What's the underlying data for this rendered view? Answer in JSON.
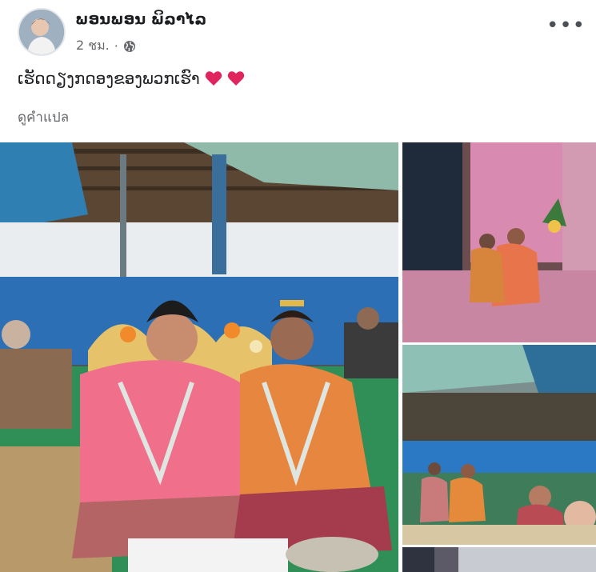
{
  "post": {
    "author_name": "ພອນພອນ ພິລາໄລ",
    "time": "2 ชม.",
    "separator": "·",
    "privacy_icon": "globe-icon",
    "more_icon": "more-options-icon",
    "more_label": "•••",
    "caption": "ເຮັດດຽງກດອງຂອງພວກເຮົາ",
    "caption_emoji": [
      "red-heart",
      "red-heart"
    ],
    "translate_label": "ดูคำแปล"
  },
  "photos": [
    {
      "name": "wedding-photo-main",
      "description": "couple in pink and orange attire seated with money garlands"
    },
    {
      "name": "wedding-photo-top-right",
      "description": "couple seated under pink backdrop"
    },
    {
      "name": "wedding-photo-middle-right",
      "description": "ceremony crowd under blue tent"
    },
    {
      "name": "wedding-photo-bottom-right",
      "description": "partially visible photo"
    }
  ],
  "colors": {
    "text_primary": "#1c1e21",
    "text_secondary": "#65676b",
    "heart": "#e0245e"
  }
}
